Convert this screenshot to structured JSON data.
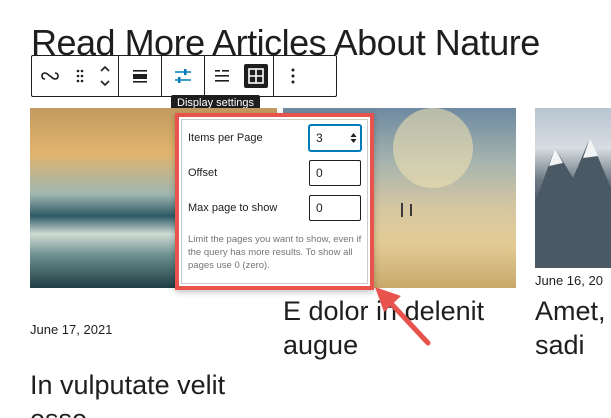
{
  "page": {
    "heading": "Read More Articles About Nature"
  },
  "toolbar": {
    "tooltip": "Display settings",
    "icons": [
      "link-icon",
      "drag-handle-icon",
      "move-up-down-icon",
      "align-icon",
      "display-settings-icon",
      "list-view-icon",
      "grid-view-icon",
      "more-options-icon"
    ]
  },
  "popover": {
    "items_per_page_label": "Items per Page",
    "items_per_page_value": "3",
    "offset_label": "Offset",
    "offset_value": "0",
    "max_page_label": "Max page to show",
    "max_page_value": "0",
    "help_text": "Limit the pages you want to show, even if the query has more results. To show all pages use 0 (zero).",
    "border_color": "#e8534d"
  },
  "posts": [
    {
      "date": "June 17, 2021",
      "title": "In vulputate velit esse"
    },
    {
      "date": "",
      "title": "E dolor in delenit augue"
    },
    {
      "date": "June 16, 20",
      "title": "Amet, sadi"
    }
  ]
}
